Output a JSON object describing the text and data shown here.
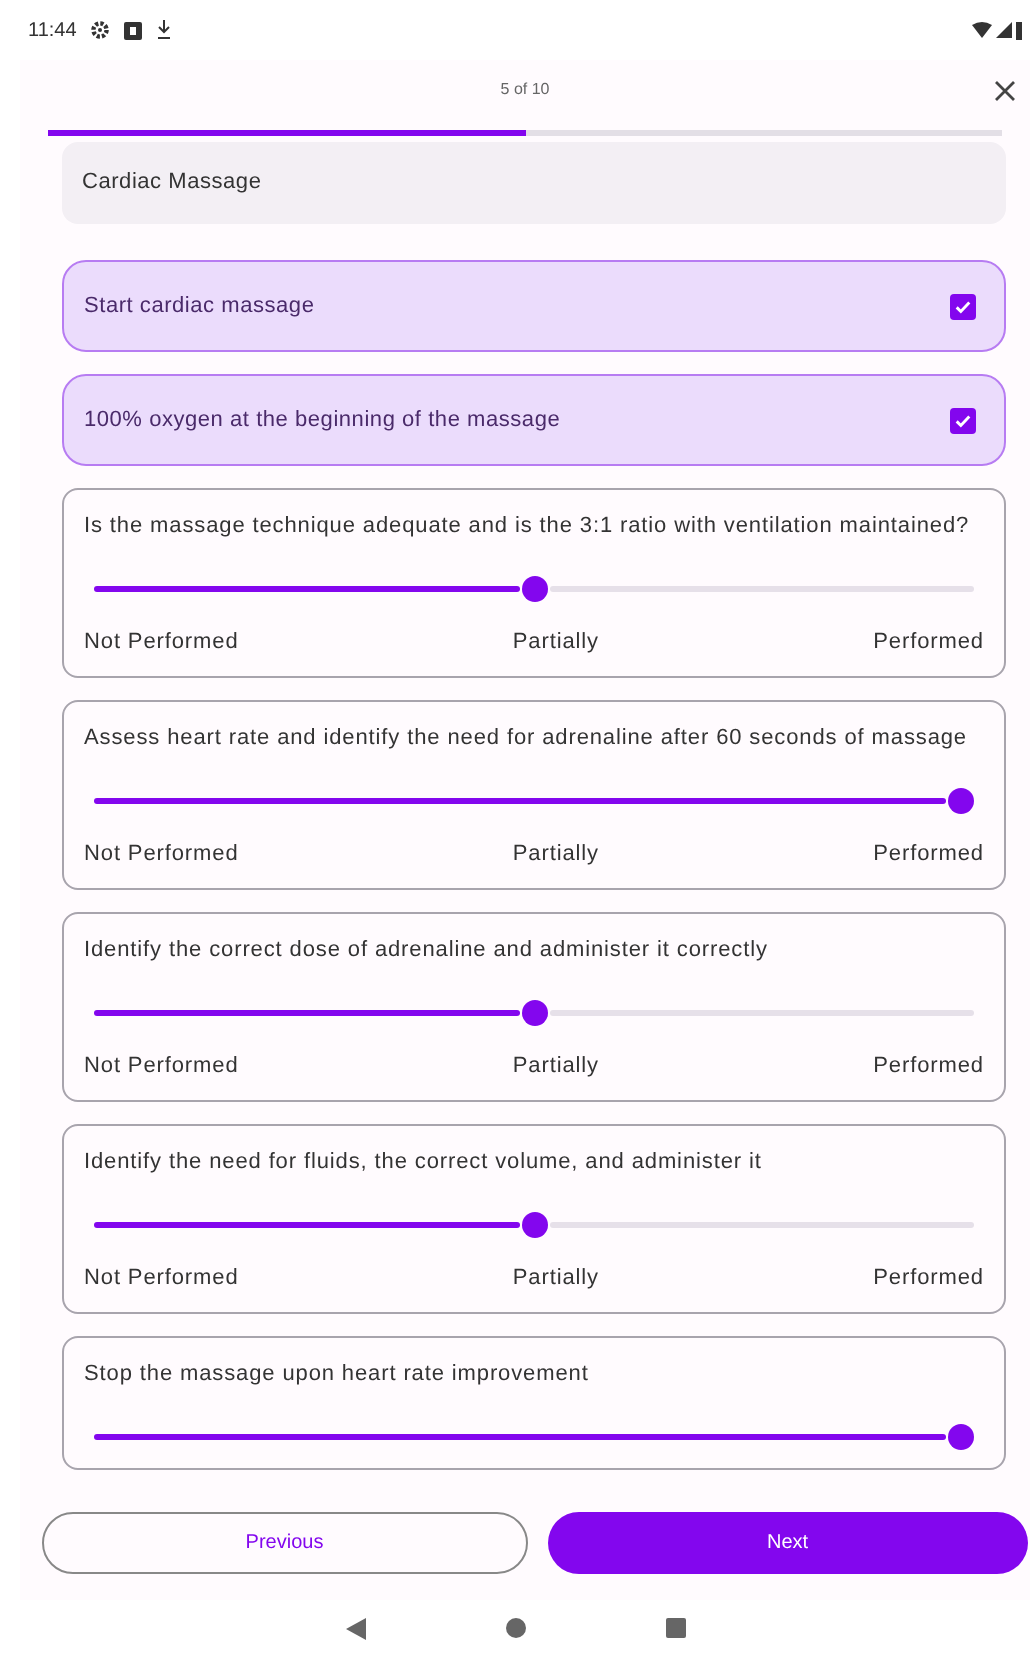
{
  "status_bar": {
    "time": "11:44"
  },
  "header": {
    "counter": "5 of 10",
    "progress": {
      "level": 0.5
    }
  },
  "section": {
    "title": "Cardiac Massage"
  },
  "items": [
    {
      "kind": "check",
      "text": "Start cardiac massage",
      "checked": true
    },
    {
      "kind": "check",
      "text": "100% oxygen at the beginning of the massage",
      "checked": true
    },
    {
      "kind": "slider",
      "text": "Is the massage technique adequate and is the 3:1 ratio with ventilation maintained?",
      "level": 0.5,
      "labels": [
        "Not Performed",
        "Partially",
        "Performed"
      ]
    },
    {
      "kind": "slider",
      "text": "Assess heart rate and identify the need for adrenaline after 60 seconds of massage",
      "level": 1,
      "labels": [
        "Not Performed",
        "Partially",
        "Performed"
      ]
    },
    {
      "kind": "slider",
      "text": "Identify the correct dose of adrenaline and administer it correctly",
      "level": 0.5,
      "labels": [
        "Not Performed",
        "Partially",
        "Performed"
      ]
    },
    {
      "kind": "slider",
      "text": "Identify the need for fluids, the correct volume, and administer it",
      "level": 0.5,
      "labels": [
        "Not Performed",
        "Partially",
        "Performed"
      ]
    },
    {
      "kind": "slider",
      "text": "Stop the massage upon heart rate improvement",
      "level": 1
    }
  ],
  "buttons": {
    "previous": "Previous",
    "next": "Next"
  }
}
